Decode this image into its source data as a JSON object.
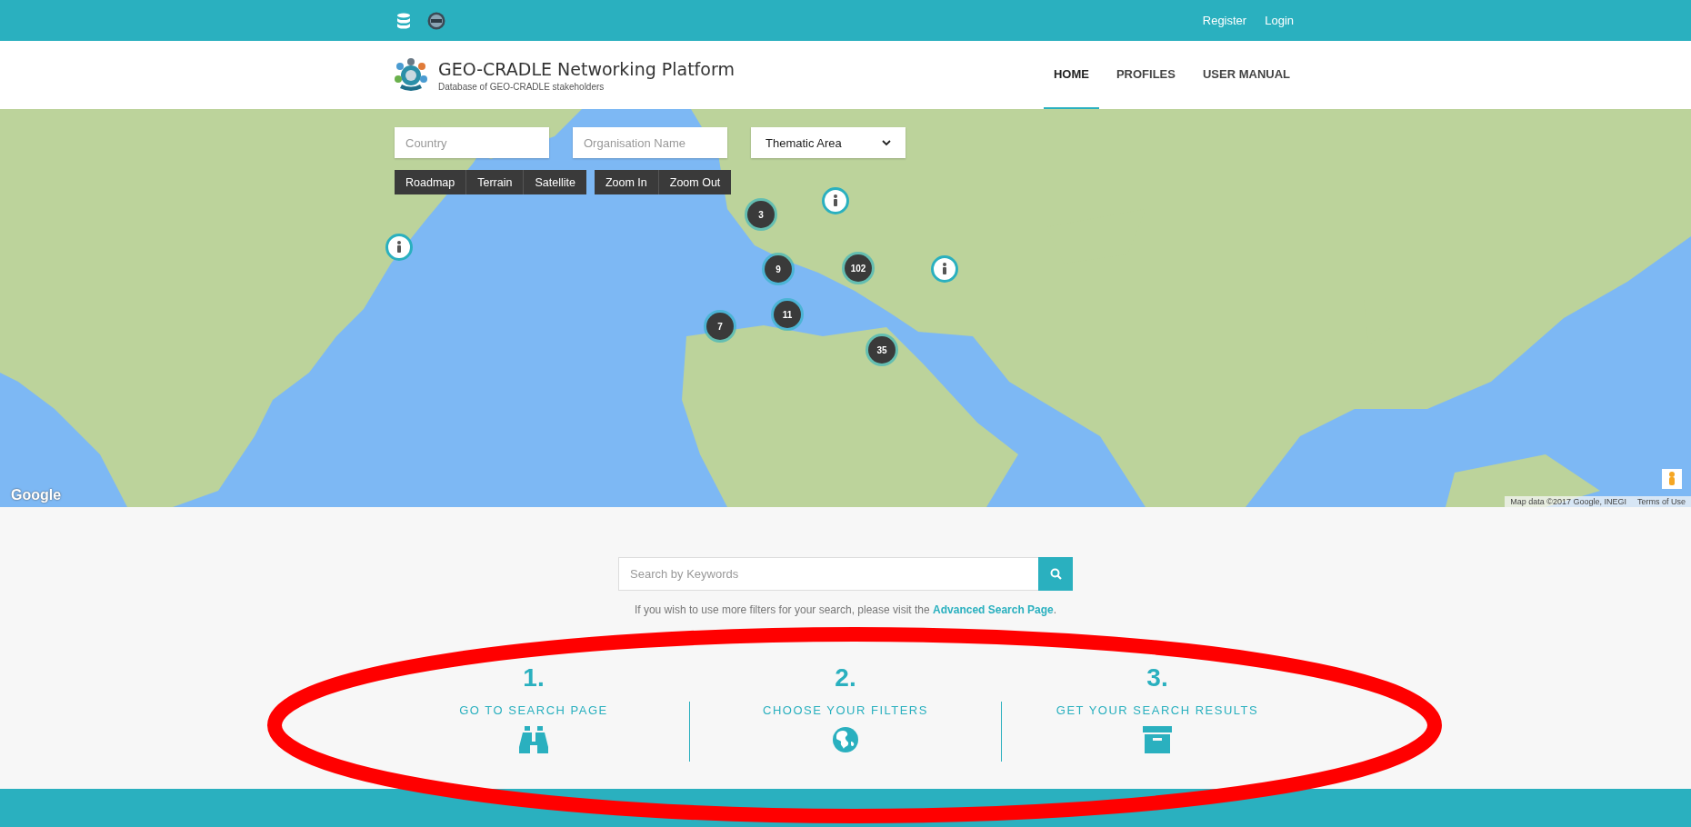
{
  "top_bar": {
    "links": [
      {
        "label": "Register"
      },
      {
        "label": "Login"
      }
    ]
  },
  "header": {
    "title": "GEO-CRADLE Networking Platform",
    "subtitle": "Database of GEO-CRADLE stakeholders",
    "nav": [
      {
        "label": "HOME",
        "selected": true
      },
      {
        "label": "PROFILES",
        "selected": false
      },
      {
        "label": "USER MANUAL",
        "selected": false
      }
    ]
  },
  "map": {
    "filters": [
      {
        "kind": "input",
        "placeholder": "Country"
      },
      {
        "kind": "input",
        "placeholder": "Organisation Name"
      },
      {
        "kind": "select",
        "value": "Thematic Area"
      }
    ],
    "map_type_buttons": [
      "Roadmap",
      "Terrain",
      "Satellite"
    ],
    "zoom_buttons": [
      "Zoom In",
      "Zoom Out"
    ],
    "markers": [
      {
        "kind": "cluster",
        "count": "3"
      },
      {
        "kind": "cluster",
        "count": "9"
      },
      {
        "kind": "cluster",
        "count": "102"
      },
      {
        "kind": "cluster",
        "count": "7"
      },
      {
        "kind": "cluster",
        "count": "11"
      },
      {
        "kind": "cluster",
        "count": "35"
      },
      {
        "kind": "pin"
      },
      {
        "kind": "pin"
      },
      {
        "kind": "pin"
      }
    ],
    "logo": "Google",
    "attribution": "Map data ©2017 Google, INEGI",
    "terms": "Terms of Use"
  },
  "search": {
    "placeholder": "Search by Keywords",
    "hint_before": "If you wish to use more filters for your search, please visit the ",
    "link": "Advanced Search Page",
    "hint_after": "."
  },
  "steps": [
    {
      "number": "1.",
      "label": "GO TO SEARCH PAGE"
    },
    {
      "number": "2.",
      "label": "CHOOSE YOUR FILTERS"
    },
    {
      "number": "3.",
      "label": "GET YOUR SEARCH RESULTS"
    }
  ],
  "annotation": {
    "kind": "ellipse"
  }
}
